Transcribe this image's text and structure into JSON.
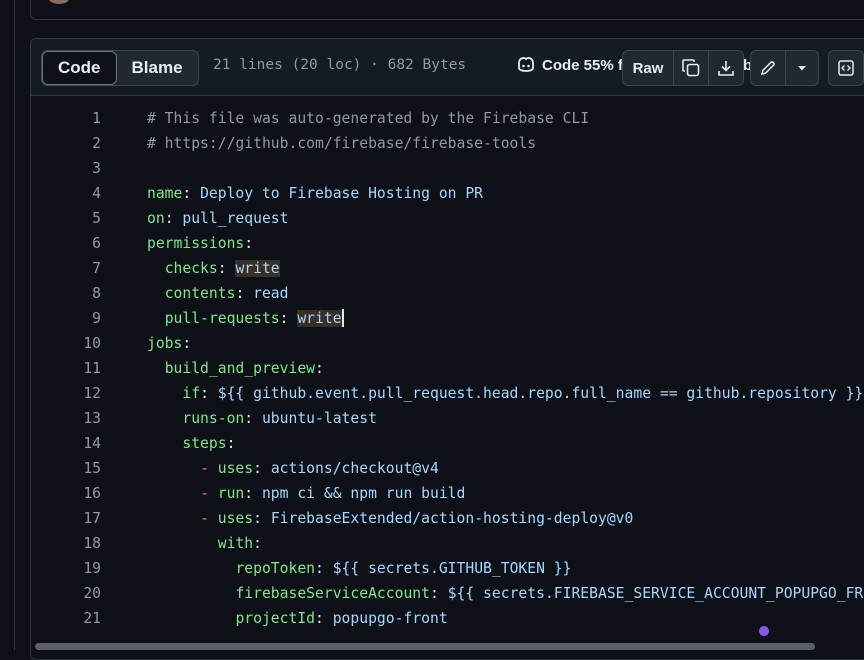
{
  "header": {
    "tabs": [
      {
        "label": "Code",
        "active": true
      },
      {
        "label": "Blame",
        "active": false
      }
    ],
    "file_info": "21 lines (20 loc) · 682 Bytes",
    "copilot_label": "Code 55% f",
    "raw_label": "Raw",
    "behind_text": "b"
  },
  "icons": {
    "copilot": "copilot-icon",
    "copy": "copy-icon",
    "download": "download-icon",
    "edit": "pencil-icon",
    "more": "triangle-down-icon",
    "symbols": "code-square-icon"
  },
  "colors": {
    "background": "#0d1117",
    "key": "#7ee787",
    "value": "#a5d6ff",
    "comment": "#9198a1",
    "dash": "#ff7b72",
    "accent_dot": "#8957e5"
  },
  "code": {
    "lines": [
      {
        "n": "1",
        "parts": [
          {
            "t": "# This file was auto-generated by the Firebase CLI",
            "c": "comment"
          }
        ]
      },
      {
        "n": "2",
        "parts": [
          {
            "t": "# https://github.com/firebase/firebase-tools",
            "c": "comment"
          }
        ]
      },
      {
        "n": "3",
        "parts": []
      },
      {
        "n": "4",
        "parts": [
          {
            "t": "name",
            "c": "key"
          },
          {
            "t": ": ",
            "c": "punc"
          },
          {
            "t": "Deploy to Firebase Hosting on PR",
            "c": "val"
          }
        ]
      },
      {
        "n": "5",
        "parts": [
          {
            "t": "on",
            "c": "key"
          },
          {
            "t": ": ",
            "c": "punc"
          },
          {
            "t": "pull_request",
            "c": "val"
          }
        ]
      },
      {
        "n": "6",
        "parts": [
          {
            "t": "permissions",
            "c": "key"
          },
          {
            "t": ":",
            "c": "punc"
          }
        ]
      },
      {
        "n": "7",
        "parts": [
          {
            "t": "  ",
            "c": "punc"
          },
          {
            "t": "checks",
            "c": "key"
          },
          {
            "t": ": ",
            "c": "punc"
          },
          {
            "t": "write",
            "c": "val",
            "hl": true
          }
        ]
      },
      {
        "n": "8",
        "parts": [
          {
            "t": "  ",
            "c": "punc"
          },
          {
            "t": "contents",
            "c": "key"
          },
          {
            "t": ": ",
            "c": "punc"
          },
          {
            "t": "read",
            "c": "val"
          }
        ]
      },
      {
        "n": "9",
        "parts": [
          {
            "t": "  ",
            "c": "punc"
          },
          {
            "t": "pull-requests",
            "c": "key"
          },
          {
            "t": ": ",
            "c": "punc"
          },
          {
            "t": "write",
            "c": "val",
            "hl": true,
            "cursor": true
          }
        ]
      },
      {
        "n": "10",
        "parts": [
          {
            "t": "jobs",
            "c": "key"
          },
          {
            "t": ":",
            "c": "punc"
          }
        ]
      },
      {
        "n": "11",
        "parts": [
          {
            "t": "  ",
            "c": "punc"
          },
          {
            "t": "build_and_preview",
            "c": "key"
          },
          {
            "t": ":",
            "c": "punc"
          }
        ]
      },
      {
        "n": "12",
        "parts": [
          {
            "t": "    ",
            "c": "punc"
          },
          {
            "t": "if",
            "c": "key"
          },
          {
            "t": ": ",
            "c": "punc"
          },
          {
            "t": "${{ github.event.pull_request.head.repo.full_name == github.repository }}",
            "c": "val"
          }
        ]
      },
      {
        "n": "13",
        "parts": [
          {
            "t": "    ",
            "c": "punc"
          },
          {
            "t": "runs-on",
            "c": "key"
          },
          {
            "t": ": ",
            "c": "punc"
          },
          {
            "t": "ubuntu-latest",
            "c": "val"
          }
        ]
      },
      {
        "n": "14",
        "parts": [
          {
            "t": "    ",
            "c": "punc"
          },
          {
            "t": "steps",
            "c": "key"
          },
          {
            "t": ":",
            "c": "punc"
          }
        ]
      },
      {
        "n": "15",
        "parts": [
          {
            "t": "      ",
            "c": "punc"
          },
          {
            "t": "- ",
            "c": "dash"
          },
          {
            "t": "uses",
            "c": "key"
          },
          {
            "t": ": ",
            "c": "punc"
          },
          {
            "t": "actions/checkout@v4",
            "c": "val"
          }
        ]
      },
      {
        "n": "16",
        "parts": [
          {
            "t": "      ",
            "c": "punc"
          },
          {
            "t": "- ",
            "c": "dash"
          },
          {
            "t": "run",
            "c": "key"
          },
          {
            "t": ": ",
            "c": "punc"
          },
          {
            "t": "npm ci && npm run build",
            "c": "val"
          }
        ]
      },
      {
        "n": "17",
        "parts": [
          {
            "t": "      ",
            "c": "punc"
          },
          {
            "t": "- ",
            "c": "dash"
          },
          {
            "t": "uses",
            "c": "key"
          },
          {
            "t": ": ",
            "c": "punc"
          },
          {
            "t": "FirebaseExtended/action-hosting-deploy@v0",
            "c": "val"
          }
        ]
      },
      {
        "n": "18",
        "parts": [
          {
            "t": "        ",
            "c": "punc"
          },
          {
            "t": "with",
            "c": "key"
          },
          {
            "t": ":",
            "c": "punc"
          }
        ]
      },
      {
        "n": "19",
        "parts": [
          {
            "t": "          ",
            "c": "punc"
          },
          {
            "t": "repoToken",
            "c": "key"
          },
          {
            "t": ": ",
            "c": "punc"
          },
          {
            "t": "${{ secrets.GITHUB_TOKEN }}",
            "c": "val"
          }
        ]
      },
      {
        "n": "20",
        "parts": [
          {
            "t": "          ",
            "c": "punc"
          },
          {
            "t": "firebaseServiceAccount",
            "c": "key"
          },
          {
            "t": ": ",
            "c": "punc"
          },
          {
            "t": "${{ secrets.FIREBASE_SERVICE_ACCOUNT_POPUPGO_FRONT }}",
            "c": "val"
          }
        ]
      },
      {
        "n": "21",
        "parts": [
          {
            "t": "          ",
            "c": "punc"
          },
          {
            "t": "projectId",
            "c": "key"
          },
          {
            "t": ": ",
            "c": "punc"
          },
          {
            "t": "popupgo-front",
            "c": "val"
          }
        ]
      }
    ]
  }
}
